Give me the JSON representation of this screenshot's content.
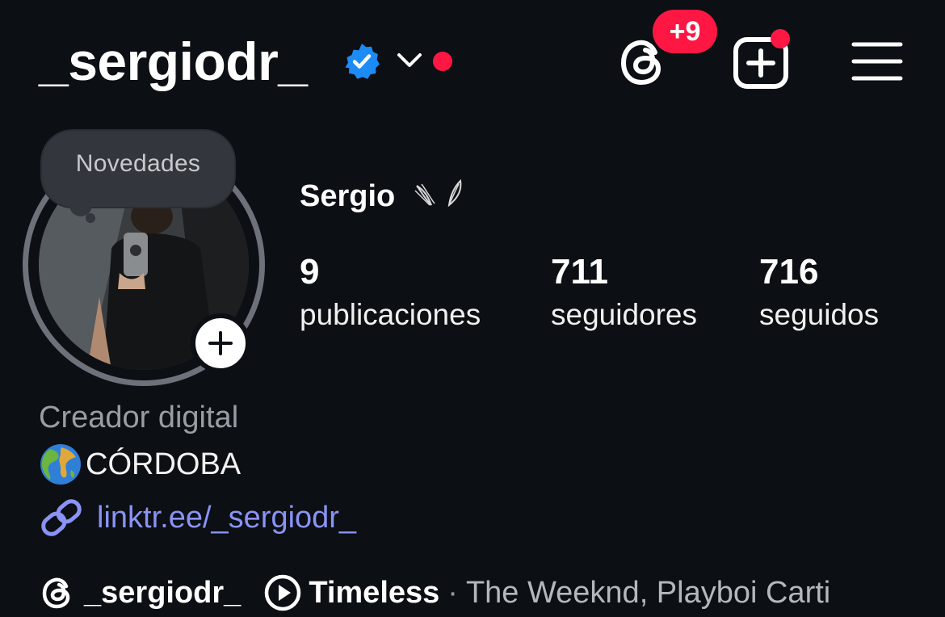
{
  "header": {
    "username": "_sergiodr_",
    "notification_badge": "+9"
  },
  "colors": {
    "background": "#0c0f14",
    "verified_blue": "#1d8bf5",
    "badge_red": "#ff1744",
    "link": "#8a93f5"
  },
  "icons": {
    "verified": "verified-badge-icon",
    "dropdown": "chevron-down-icon",
    "threads": "threads-icon",
    "create": "plus-square-icon",
    "menu": "hamburger-menu-icon",
    "add_story": "plus-icon",
    "location": "globe-emoji-icon",
    "link": "link-icon",
    "music": "play-circle-icon"
  },
  "profile": {
    "note": "Novedades",
    "display_name": "Sergio",
    "stats": [
      {
        "value": "9",
        "label": "publicaciones"
      },
      {
        "value": "711",
        "label": "seguidores"
      },
      {
        "value": "716",
        "label": "seguidos"
      }
    ]
  },
  "bio": {
    "category": "Creador digital",
    "location": "CÓRDOBA",
    "link": "linktr.ee/_sergiodr_"
  },
  "footer": {
    "threads_username": "_sergiodr_",
    "song_title": "Timeless",
    "separator": "·",
    "song_artists": "The Weeknd, Playboi Carti"
  }
}
